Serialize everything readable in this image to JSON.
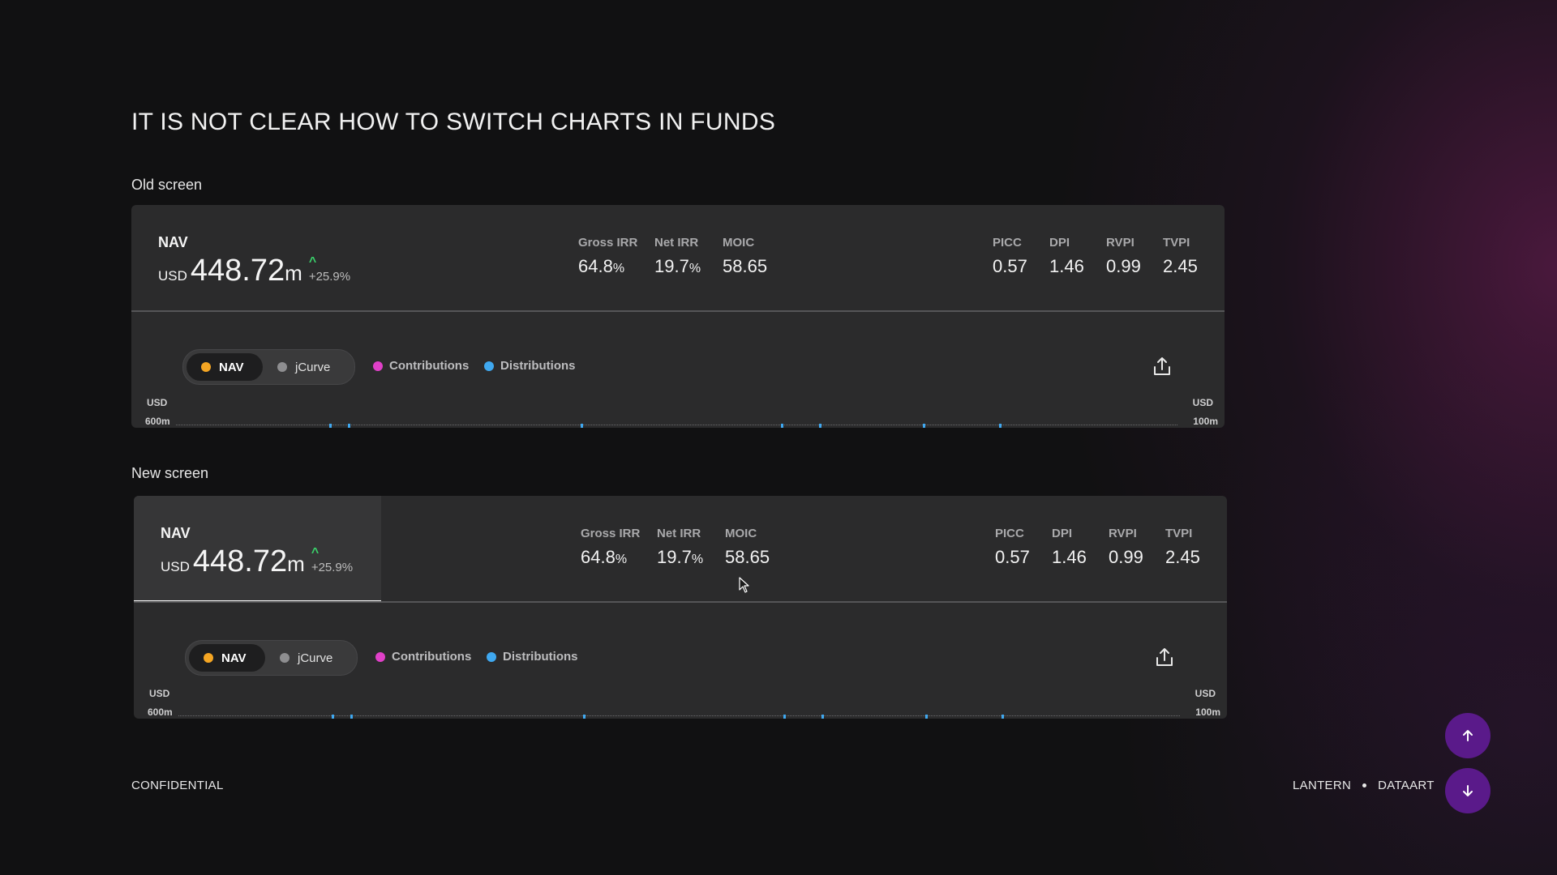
{
  "page": {
    "title": "IT IS NOT CLEAR HOW TO SWITCH CHARTS IN FUNDS"
  },
  "sections": {
    "old": {
      "label": "Old screen"
    },
    "new": {
      "label": "New screen"
    }
  },
  "summary": {
    "nav_label": "NAV",
    "currency": "USD",
    "nav_value": "448.72",
    "nav_unit": "m",
    "nav_change": "+25.9%",
    "metrics_left": [
      {
        "label": "Gross IRR",
        "value": "64.8",
        "suffix": "%"
      },
      {
        "label": "Net IRR",
        "value": "19.7",
        "suffix": "%"
      },
      {
        "label": "MOIC",
        "value": "58.65",
        "suffix": ""
      }
    ],
    "metrics_right": [
      {
        "label": "PICC",
        "value": "0.57"
      },
      {
        "label": "DPI",
        "value": "1.46"
      },
      {
        "label": "RVPI",
        "value": "0.99"
      },
      {
        "label": "TVPI",
        "value": "2.45"
      }
    ]
  },
  "chart_controls": {
    "toggle_nav": "NAV",
    "toggle_jcurve": "jCurve",
    "legend_contributions": "Contributions",
    "legend_distributions": "Distributions",
    "left_axis_currency": "USD",
    "left_axis_top": "600m",
    "right_axis_currency": "USD",
    "right_axis_top": "100m"
  },
  "colors": {
    "nav_dot": "#f5a623",
    "jcurve_dot": "#8e8e90",
    "contributions_dot": "#e040c8",
    "distributions_dot": "#3fa8f0",
    "change_up": "#3ad36b",
    "nav_button": "#5a1a8a"
  },
  "icons": {
    "change": "chevron-up-icon",
    "export": "upload-icon",
    "scroll_up": "arrow-up-icon",
    "scroll_down": "arrow-down-icon",
    "cursor": "mouse-pointer-icon"
  },
  "footer": {
    "left": "CONFIDENTIAL",
    "brand_1": "LANTERN",
    "brand_2": "DATAART"
  }
}
